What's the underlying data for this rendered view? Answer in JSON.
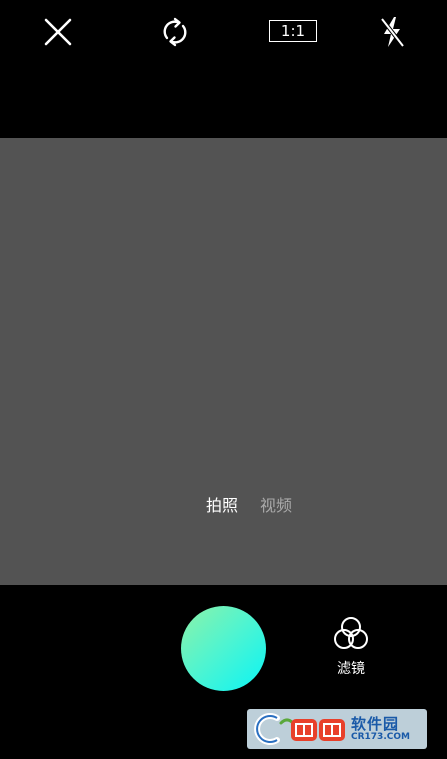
{
  "toolbar": {
    "ratio_label": "1:1"
  },
  "icons": {
    "close": "close-icon",
    "switch_camera": "switch-camera-icon",
    "flash": "flash-off-icon",
    "filter": "filter-icon"
  },
  "modes": {
    "photo": "拍照",
    "video": "视频",
    "active": "photo"
  },
  "bottom": {
    "filter_label": "滤镜"
  },
  "colors": {
    "background": "#000000",
    "viewfinder": "#535353",
    "shutter_start": "#8df2a8",
    "shutter_end": "#0af5f5",
    "mode_active": "#ffffff",
    "mode_inactive": "#a9a9a9"
  },
  "watermark": {
    "brand": "软件园",
    "url": "CR173.COM"
  }
}
